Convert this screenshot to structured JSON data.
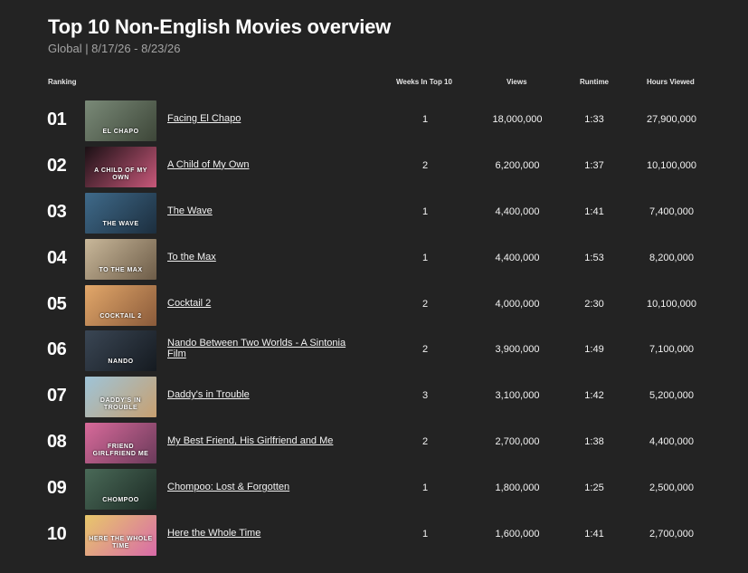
{
  "header": {
    "title": "Top 10 Non-English Movies overview",
    "subtitle": "Global | 8/17/26 - 8/23/26"
  },
  "columns": {
    "ranking": "Ranking",
    "weeks": "Weeks In Top 10",
    "views": "Views",
    "runtime": "Runtime",
    "hours": "Hours Viewed"
  },
  "rows": [
    {
      "rank": "01",
      "title": "Facing El Chapo",
      "weeks": "1",
      "views": "18,000,000",
      "runtime": "1:33",
      "hours": "27,900,000",
      "thumb_text": "EL CHAPO",
      "c1": "#7a8a78",
      "c2": "#3d4638"
    },
    {
      "rank": "02",
      "title": "A Child of My Own",
      "weeks": "2",
      "views": "6,200,000",
      "runtime": "1:37",
      "hours": "10,100,000",
      "thumb_text": "A CHILD OF MY OWN",
      "c1": "#1a1014",
      "c2": "#c8587a"
    },
    {
      "rank": "03",
      "title": "The Wave",
      "weeks": "1",
      "views": "4,400,000",
      "runtime": "1:41",
      "hours": "7,400,000",
      "thumb_text": "THE WAVE",
      "c1": "#3f6a8a",
      "c2": "#1c2e3e"
    },
    {
      "rank": "04",
      "title": "To the Max",
      "weeks": "1",
      "views": "4,400,000",
      "runtime": "1:53",
      "hours": "8,200,000",
      "thumb_text": "TO THE MAX",
      "c1": "#c9b89a",
      "c2": "#6d5c48"
    },
    {
      "rank": "05",
      "title": "Cocktail 2",
      "weeks": "2",
      "views": "4,000,000",
      "runtime": "2:30",
      "hours": "10,100,000",
      "thumb_text": "COCKTAIL 2",
      "c1": "#e3a86a",
      "c2": "#8a5a3a"
    },
    {
      "rank": "06",
      "title": "Nando Between Two Worlds - A Sintonia Film",
      "weeks": "2",
      "views": "3,900,000",
      "runtime": "1:49",
      "hours": "7,100,000",
      "thumb_text": "NANDO",
      "c1": "#3a4654",
      "c2": "#151a20"
    },
    {
      "rank": "07",
      "title": "Daddy's in Trouble",
      "weeks": "3",
      "views": "3,100,000",
      "runtime": "1:42",
      "hours": "5,200,000",
      "thumb_text": "DADDY'S IN TROUBLE",
      "c1": "#9ec4d8",
      "c2": "#c8a070"
    },
    {
      "rank": "08",
      "title": "My Best Friend, His Girlfriend and Me",
      "weeks": "2",
      "views": "2,700,000",
      "runtime": "1:38",
      "hours": "4,400,000",
      "thumb_text": "FRIEND GIRLFRIEND ME",
      "c1": "#d86a9a",
      "c2": "#6a3a5a"
    },
    {
      "rank": "09",
      "title": "Chompoo: Lost & Forgotten",
      "weeks": "1",
      "views": "1,800,000",
      "runtime": "1:25",
      "hours": "2,500,000",
      "thumb_text": "CHOMPOO",
      "c1": "#4a6a58",
      "c2": "#1c2a24"
    },
    {
      "rank": "10",
      "title": "Here the Whole Time",
      "weeks": "1",
      "views": "1,600,000",
      "runtime": "1:41",
      "hours": "2,700,000",
      "thumb_text": "HERE THE WHOLE TIME",
      "c1": "#e8c86a",
      "c2": "#d86aa8"
    }
  ]
}
